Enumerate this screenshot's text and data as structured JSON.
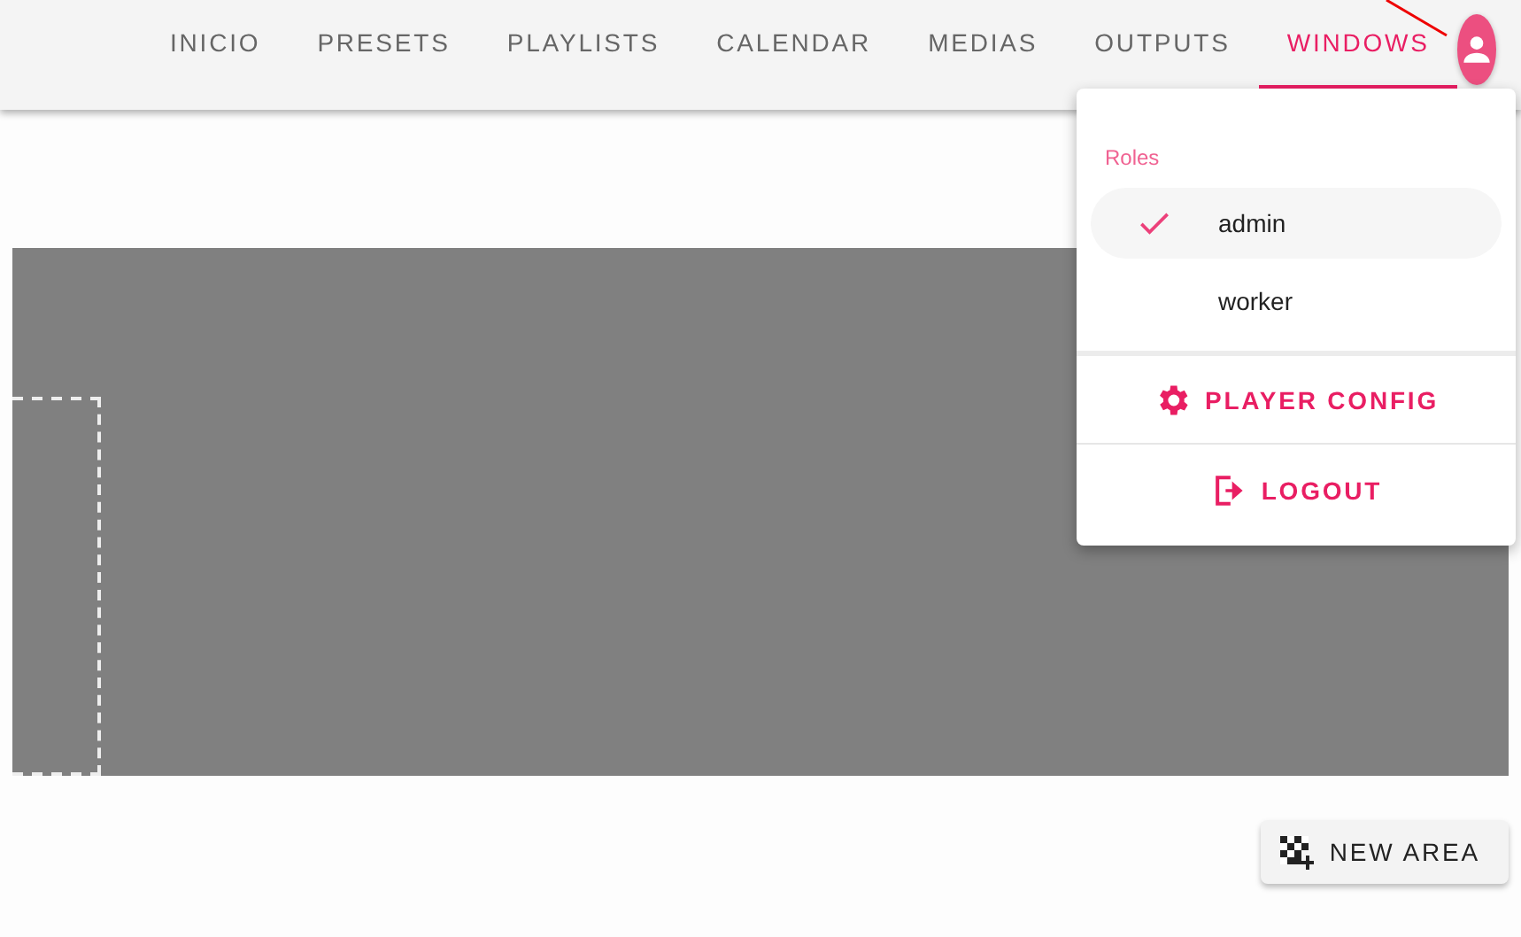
{
  "nav": {
    "tabs": [
      {
        "label": "INICIO",
        "selected": false
      },
      {
        "label": "PRESETS",
        "selected": false
      },
      {
        "label": "PLAYLISTS",
        "selected": false
      },
      {
        "label": "CALENDAR",
        "selected": false
      },
      {
        "label": "MEDIAS",
        "selected": false
      },
      {
        "label": "OUTPUTS",
        "selected": false
      },
      {
        "label": "WINDOWS",
        "selected": true
      }
    ]
  },
  "user_menu": {
    "section_title": "Roles",
    "roles": [
      {
        "label": "admin",
        "selected": true
      },
      {
        "label": "worker",
        "selected": false
      }
    ],
    "actions": [
      {
        "label": "PLAYER CONFIG",
        "kind": "settings"
      },
      {
        "label": "LOGOUT",
        "kind": "logout"
      }
    ]
  },
  "new_area_button": {
    "label": "NEW AREA"
  }
}
